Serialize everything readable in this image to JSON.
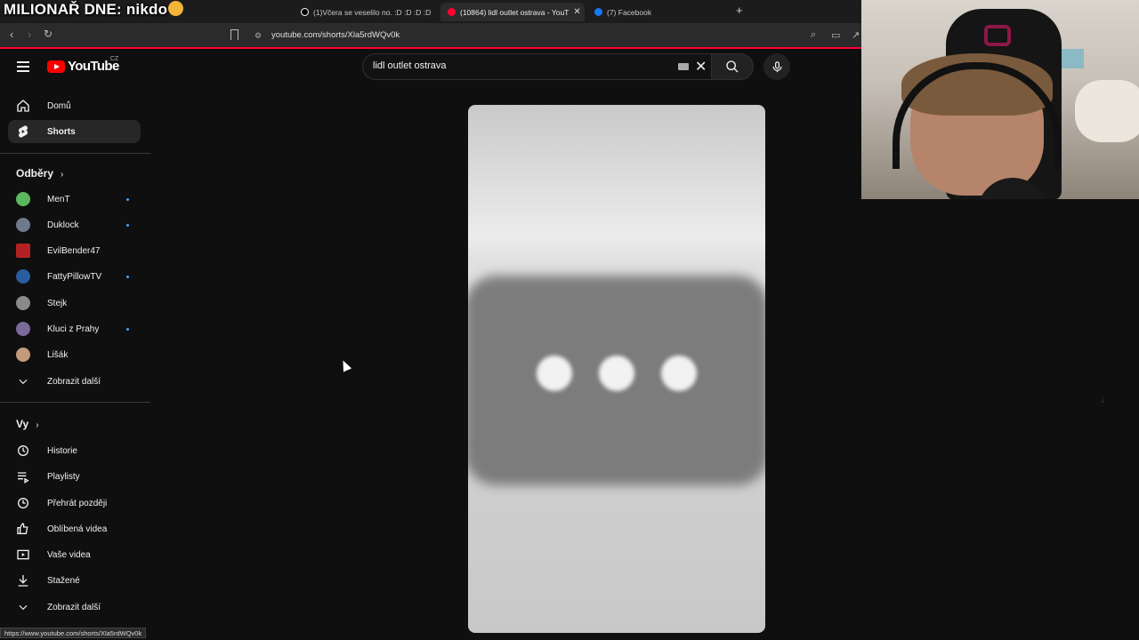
{
  "overlay": {
    "title": "MILIONAŘ DNE: nikdo"
  },
  "browser": {
    "tabs": [
      {
        "label": "(1)Včera se veselilo no. :D :D :D :D"
      },
      {
        "label": "(10864) lidl outlet ostrava - YouT"
      },
      {
        "label": "(7) Facebook"
      }
    ],
    "tab_ghost": "",
    "new_tab": "+",
    "url": "youtube.com/shorts/Xla5rdWQv0k",
    "status_url": "https://www.youtube.com/shorts/Xla5rdWQv0k",
    "accent": "#ff0033"
  },
  "header": {
    "logo_text": "YouTube",
    "country": "CZ",
    "search_value": "lidl outlet ostrava"
  },
  "sidebar": {
    "main": [
      {
        "label": "Domů",
        "icon": "home-icon"
      },
      {
        "label": "Shorts",
        "icon": "shorts-icon"
      }
    ],
    "subs_title": "Odběry",
    "subs": [
      {
        "label": "MenT",
        "dot": true,
        "color": "#5cb85c"
      },
      {
        "label": "Duklock",
        "dot": true,
        "color": "#6d7a8c"
      },
      {
        "label": "EvilBender47",
        "dot": false,
        "color": "#b22222"
      },
      {
        "label": "FattyPillowTV",
        "dot": true,
        "color": "#2a5d9f"
      },
      {
        "label": "Stejk",
        "dot": false,
        "color": "#8a8a8a"
      },
      {
        "label": "Kluci z Prahy",
        "dot": true,
        "color": "#7a6a9a"
      },
      {
        "label": "Lišák",
        "dot": false,
        "color": "#c49a7a"
      }
    ],
    "subs_more": "Zobrazit další",
    "you_title": "Vy",
    "you": [
      {
        "label": "Historie",
        "icon": "history-icon"
      },
      {
        "label": "Playlisty",
        "icon": "playlist-icon"
      },
      {
        "label": "Přehrát později",
        "icon": "watch-later-icon"
      },
      {
        "label": "Oblíbená videa",
        "icon": "like-icon"
      },
      {
        "label": "Vaše videa",
        "icon": "your-videos-icon"
      },
      {
        "label": "Stažené",
        "icon": "download-icon"
      }
    ],
    "you_more": "Zobrazit další"
  }
}
